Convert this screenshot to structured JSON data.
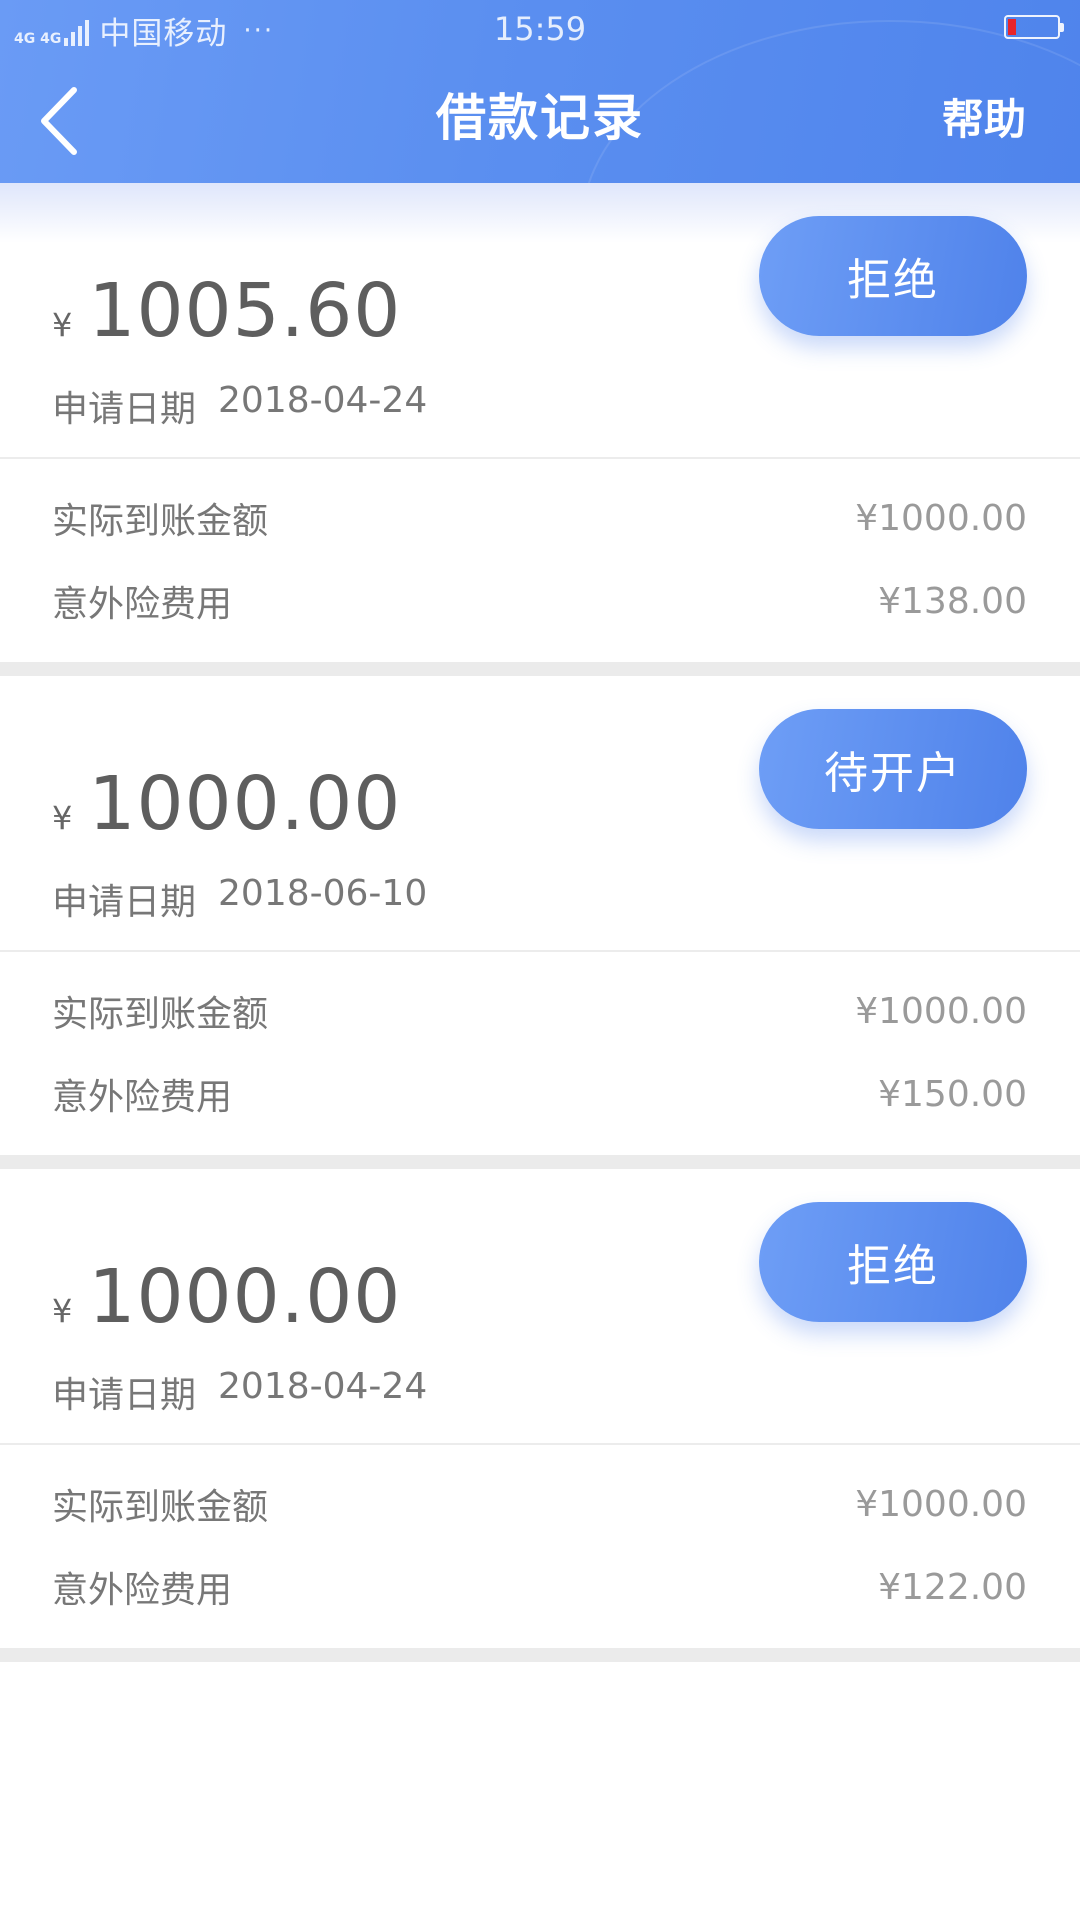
{
  "status_bar": {
    "network": "4G 4G",
    "carrier": "中国移动",
    "dots": "···",
    "time": "15:59"
  },
  "header": {
    "title": "借款记录",
    "help": "帮助"
  },
  "records": [
    {
      "currency": "¥",
      "amount": "1005.60",
      "date_label": "申请日期",
      "date": "2018-04-24",
      "status": "拒绝",
      "actual_label": "实际到账金额",
      "actual_value": "¥1000.00",
      "insurance_label": "意外险费用",
      "insurance_value": "¥138.00"
    },
    {
      "currency": "¥",
      "amount": "1000.00",
      "date_label": "申请日期",
      "date": "2018-06-10",
      "status": "待开户",
      "actual_label": "实际到账金额",
      "actual_value": "¥1000.00",
      "insurance_label": "意外险费用",
      "insurance_value": "¥150.00"
    },
    {
      "currency": "¥",
      "amount": "1000.00",
      "date_label": "申请日期",
      "date": "2018-04-24",
      "status": "拒绝",
      "actual_label": "实际到账金额",
      "actual_value": "¥1000.00",
      "insurance_label": "意外险费用",
      "insurance_value": "¥122.00"
    }
  ],
  "colors": {
    "accent": "#5b8ff0",
    "battery_low": "#e8252b"
  }
}
